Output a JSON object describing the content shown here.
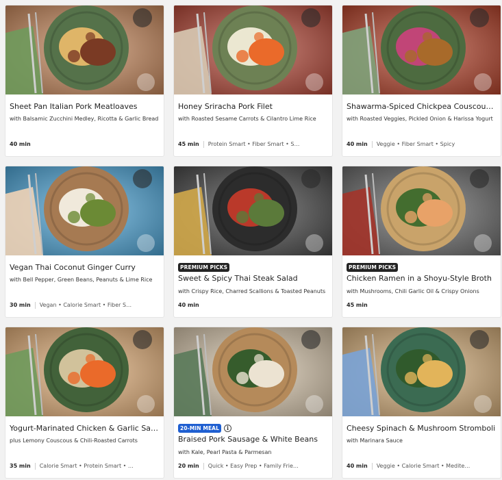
{
  "recipes": [
    {
      "title": "Sheet Pan Italian Pork Meatloaves",
      "subtitle": "with Balsamic Zucchini Medley, Ricotta & Garlic Bread",
      "time": "40 min",
      "tags": "",
      "badge": "",
      "info_icon": ""
    },
    {
      "title": "Honey Sriracha Pork Filet",
      "subtitle": "with Roasted Sesame Carrots & Cilantro Lime Rice",
      "time": "45 min",
      "tags": "Protein Smart • Fiber Smart • S…",
      "badge": "",
      "info_icon": ""
    },
    {
      "title": "Shawarma-Spiced Chickpea Couscous Bowls",
      "subtitle": "with Roasted Veggies, Pickled Onion & Harissa Yogurt",
      "time": "40 min",
      "tags": "Veggie • Fiber Smart • Spicy",
      "badge": "",
      "info_icon": ""
    },
    {
      "title": "Vegan Thai Coconut Ginger Curry",
      "subtitle": "with Bell Pepper, Green Beans, Peanuts & Lime Rice",
      "time": "30 min",
      "tags": "Vegan • Calorie Smart • Fiber S…",
      "badge": "",
      "info_icon": ""
    },
    {
      "title": "Sweet & Spicy Thai Steak Salad",
      "subtitle": "with Crispy Rice, Charred Scallions & Toasted Peanuts",
      "time": "40 min",
      "tags": "",
      "badge": "PREMIUM PICKS",
      "info_icon": ""
    },
    {
      "title": "Chicken Ramen in a Shoyu-Style Broth",
      "subtitle": "with Mushrooms, Chili Garlic Oil & Crispy Onions",
      "time": "45 min",
      "tags": "",
      "badge": "PREMIUM PICKS",
      "info_icon": ""
    },
    {
      "title": "Yogurt-Marinated Chicken & Garlic Sauce",
      "subtitle": "plus Lemony Couscous & Chili-Roasted Carrots",
      "time": "35 min",
      "tags": "Calorie Smart • Protein Smart • …",
      "badge": "",
      "info_icon": ""
    },
    {
      "title": "Braised Pork Sausage & White Beans",
      "subtitle": "with Kale, Pearl Pasta & Parmesan",
      "time": "20 min",
      "tags": "Quick • Easy Prep • Family Frie…",
      "badge": "20-MIN MEAL",
      "info_icon": "info-icon"
    },
    {
      "title": "Cheesy Spinach & Mushroom Stromboli",
      "subtitle": "with Marinara Sauce",
      "time": "40 min",
      "tags": "Veggie • Calorie Smart • Medite…",
      "badge": "",
      "info_icon": ""
    }
  ],
  "info_glyph": "i",
  "colors": {
    "premium_badge": "#242424",
    "quick_badge": "#1f5fd1",
    "background": "#f2f2f2"
  },
  "photos": [
    {
      "board": "#c98a5e",
      "plate": "#55724a",
      "food": "#7a3a24",
      "accent": "#e7b869",
      "cloth": "#6f9a5c"
    },
    {
      "board": "#b74a3a",
      "plate": "#6d8154",
      "food": "#ea6a2a",
      "accent": "#f2ecd8",
      "cloth": "#d7c9b3"
    },
    {
      "board": "#b8462e",
      "plate": "#4d6b40",
      "food": "#a86a2a",
      "accent": "#c7437a",
      "cloth": "#7fa27a"
    },
    {
      "board": "#4fa7d9",
      "plate": "#a67a52",
      "food": "#6b8a35",
      "accent": "#f3efe3",
      "cloth": "#f0d3b6"
    },
    {
      "board": "#4a4a4a",
      "plate": "#2c2c2c",
      "food": "#5b7a3a",
      "accent": "#c23a2a",
      "cloth": "#d2a84a"
    },
    {
      "board": "#6b6b6b",
      "plate": "#c9a36a",
      "food": "#e8a268",
      "accent": "#3c6a2c",
      "cloth": "#a3342a"
    },
    {
      "board": "#e3b07a",
      "plate": "#42623a",
      "food": "#ea6a2a",
      "accent": "#d9c7a0",
      "cloth": "#6f9a5c"
    },
    {
      "board": "#d8c7ad",
      "plate": "#b58a5a",
      "food": "#ece3d2",
      "accent": "#2f5a2a",
      "cloth": "#5a7a5a"
    },
    {
      "board": "#d9b27e",
      "plate": "#3b6b52",
      "food": "#e2b45a",
      "accent": "#2f5a2a",
      "cloth": "#7aa3d6"
    }
  ]
}
